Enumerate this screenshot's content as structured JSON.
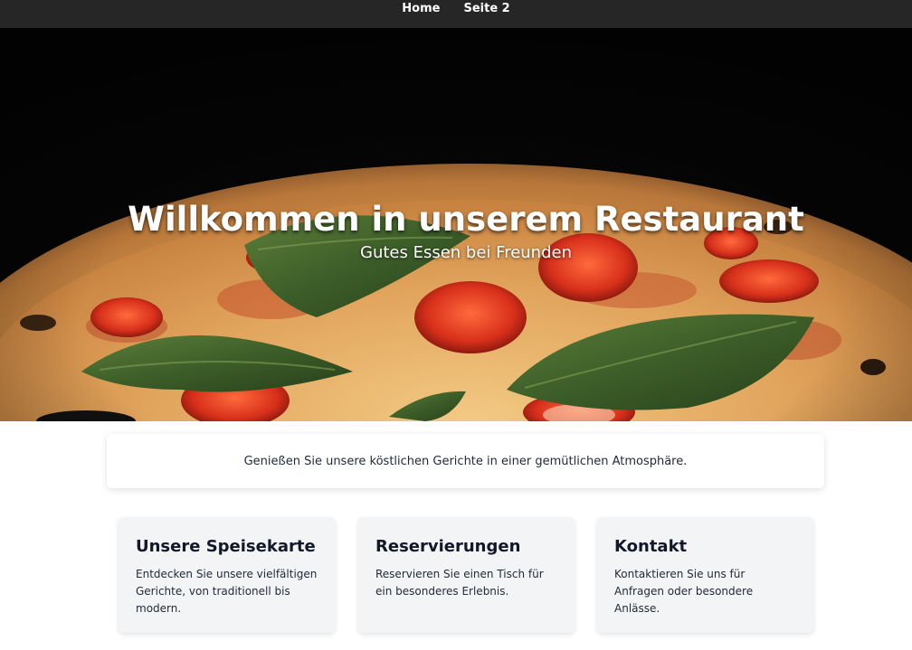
{
  "nav": {
    "items": [
      {
        "label": "Home"
      },
      {
        "label": "Seite 2"
      }
    ]
  },
  "hero": {
    "title": "Willkommen in unserem Restaurant",
    "subtitle": "Gutes Essen bei Freunden",
    "image": "pizza-photo"
  },
  "intro": {
    "text": "Genießen Sie unsere köstlichen Gerichte in einer gemütlichen Atmosphäre."
  },
  "cards": [
    {
      "title": "Unsere Speisekarte",
      "text": "Entdecken Sie unsere vielfältigen Gerichte, von traditionell bis modern."
    },
    {
      "title": "Reservierungen",
      "text": "Reservieren Sie einen Tisch für ein besonderes Erlebnis."
    },
    {
      "title": "Kontakt",
      "text": "Kontaktieren Sie uns für Anfragen oder besondere Anlässe."
    }
  ],
  "colors": {
    "navbar": "#262626",
    "hero_background": "#050505",
    "card_background": "#f3f4f6"
  }
}
